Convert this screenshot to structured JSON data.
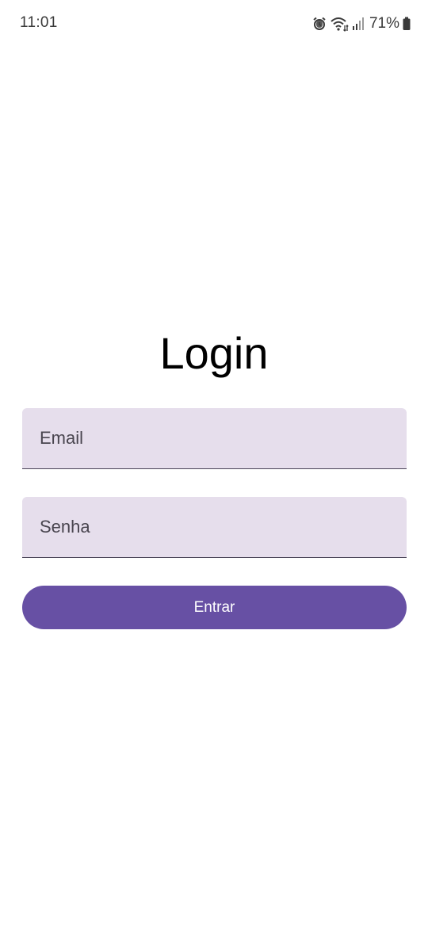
{
  "status_bar": {
    "time": "11:01",
    "battery_percent": "71%",
    "icons": [
      "alarm-icon",
      "wifi-icon",
      "signal-icon",
      "battery-icon"
    ]
  },
  "login": {
    "title": "Login",
    "email_placeholder": "Email",
    "password_placeholder": "Senha",
    "submit_label": "Entrar"
  },
  "colors": {
    "primary": "#6750a4",
    "field_background": "#e6deec",
    "field_text": "#49454f",
    "background": "#ffffff"
  }
}
